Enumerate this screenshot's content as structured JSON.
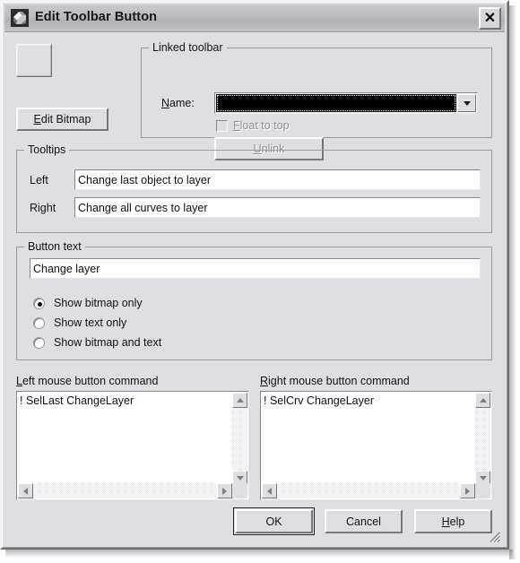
{
  "window": {
    "title": "Edit Toolbar Button",
    "icon_name": "toolbar-button-icon",
    "close_label": "✕"
  },
  "bitmap": {
    "preview_name": "bitmap-preview",
    "edit_button_prefix": "E",
    "edit_button_rest": "dit Bitmap"
  },
  "linked_toolbar": {
    "group_label": "Linked toolbar",
    "name_label_prefix": "N",
    "name_label_rest": "ame:",
    "name_value": "",
    "float_to_top_prefix": "F",
    "float_to_top_rest": "loat to top",
    "float_to_top_checked": false,
    "float_to_top_enabled": false,
    "unlink_prefix": "U",
    "unlink_rest": "nlink",
    "unlink_enabled": false
  },
  "tooltips": {
    "group_label": "Tooltips",
    "left_label": "Left",
    "left_value": "Change last object to layer",
    "right_label": "Right",
    "right_value": "Change all curves to layer"
  },
  "button_text": {
    "group_label": "Button text",
    "value": "Change layer",
    "options": [
      {
        "label": "Show bitmap only",
        "selected": true
      },
      {
        "label": "Show text only",
        "selected": false
      },
      {
        "label": "Show bitmap and text",
        "selected": false
      }
    ]
  },
  "commands": {
    "left_label_prefix": "L",
    "left_label_rest": "eft mouse button command",
    "left_value": "! SelLast ChangeLayer",
    "right_label_prefix": "R",
    "right_label_rest": "ight mouse button command",
    "right_value": "! SelCrv ChangeLayer"
  },
  "footer": {
    "ok": "OK",
    "cancel": "Cancel",
    "help_prefix": "H",
    "help_rest": "elp"
  },
  "colors": {
    "dialog_face": "#dfdfe3",
    "titlebar": "#bdbdc1",
    "field_bg": "#ffffff",
    "text": "#111118",
    "disabled_text": "#8e8e96",
    "combo_selected_bg": "#000000"
  }
}
